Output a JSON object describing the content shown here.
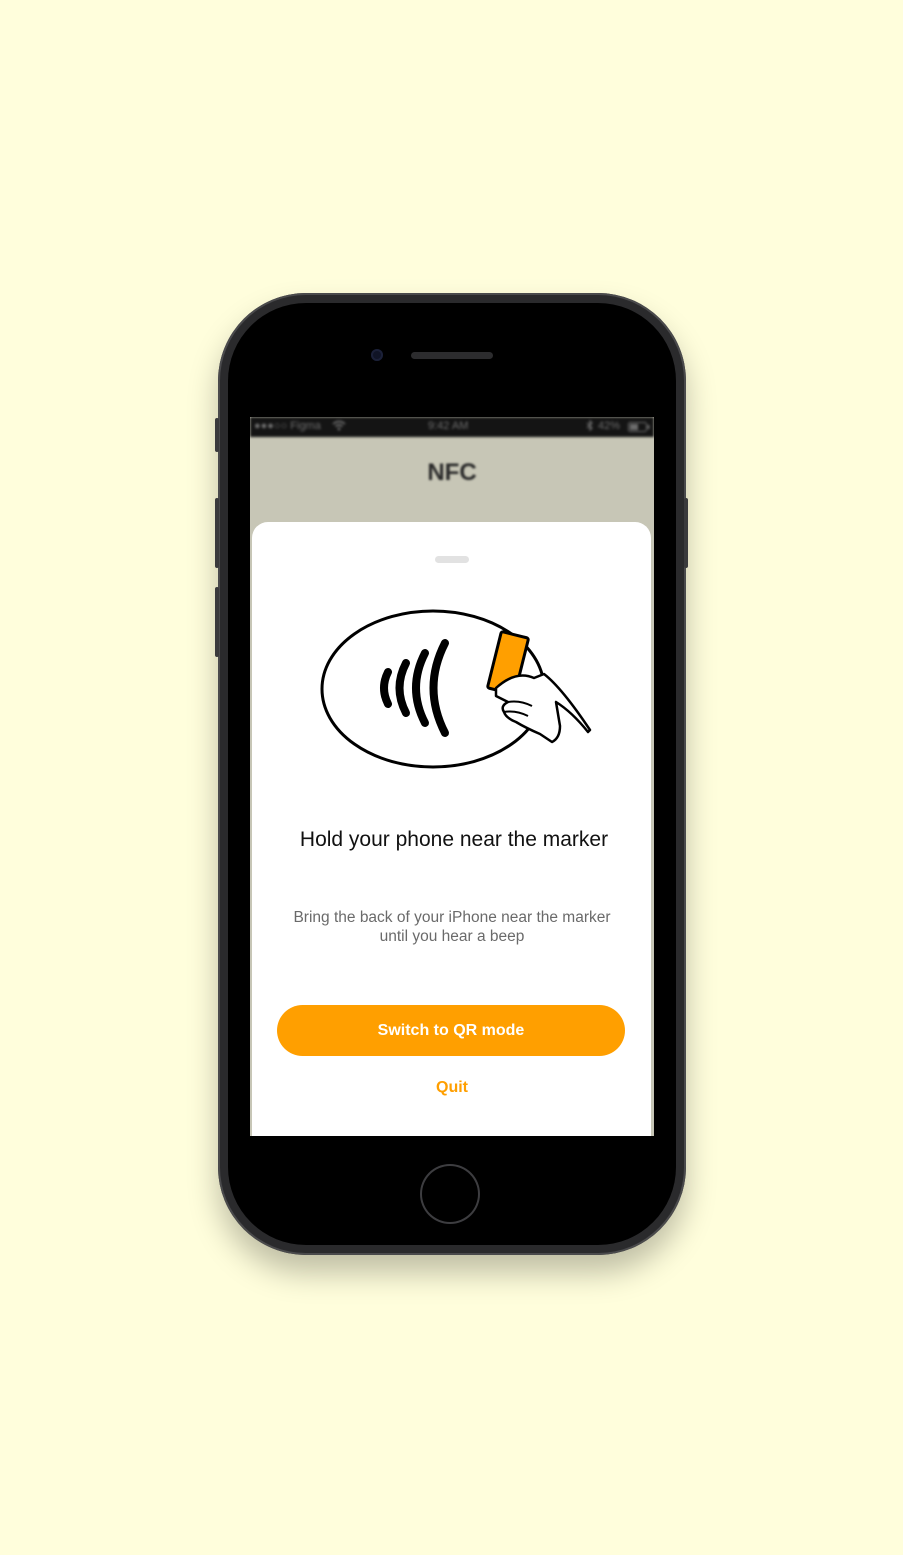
{
  "colors": {
    "background": "#FFFEDC",
    "accent": "#FF9F00",
    "phone_body": "#2a2a2c"
  },
  "status_bar": {
    "carrier": "●●●○○ Figma",
    "wifi_icon": "wifi-icon",
    "time": "9:42 AM",
    "bluetooth_icon": "bluetooth-icon",
    "battery": "42%"
  },
  "nav": {
    "title": "NFC"
  },
  "sheet": {
    "illustration_icon": "contactless-tap-icon",
    "title": "Hold your phone near the marker",
    "description": "Bring the back of your iPhone near the marker until you hear a beep",
    "primary_button": "Switch to QR mode",
    "secondary_button": "Quit"
  }
}
